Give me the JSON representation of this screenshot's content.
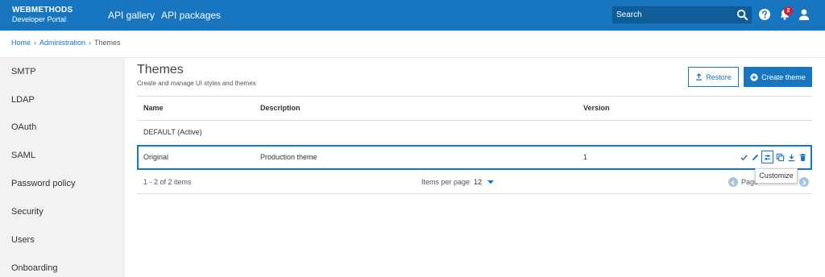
{
  "header": {
    "logo_line1": "WEBMETHODS",
    "logo_line2": "Developer Portal",
    "nav": [
      "API gallery",
      "API packages"
    ],
    "search_placeholder": "Search",
    "notification_count": "2",
    "colors": {
      "bar": "#1776bf",
      "badge": "#d3202f"
    }
  },
  "breadcrumb": [
    "Home",
    "Administration",
    "Themes"
  ],
  "sidebar": {
    "items": [
      "SMTP",
      "LDAP",
      "OAuth",
      "SAML",
      "Password policy",
      "Security",
      "Users",
      "Onboarding"
    ]
  },
  "main": {
    "title": "Themes",
    "subtitle": "Create and manage UI styles and themes",
    "restore_label": "Restore",
    "create_label": "Create theme"
  },
  "table": {
    "columns": [
      "Name",
      "Description",
      "Version"
    ],
    "rows": [
      {
        "name": "DEFAULT (Active)",
        "description": "",
        "version": ""
      },
      {
        "name": "Original",
        "description": "Production theme",
        "version": "1"
      }
    ],
    "row_actions": [
      "check-icon",
      "edit-icon",
      "customize-icon",
      "copy-icon",
      "download-icon",
      "delete-icon"
    ],
    "tooltip": "Customize"
  },
  "pagination": {
    "count": "1 - 2 of 2 items",
    "items_per_page_label": "Items per page",
    "items_per_page_value": "12",
    "page_label": "Page"
  }
}
